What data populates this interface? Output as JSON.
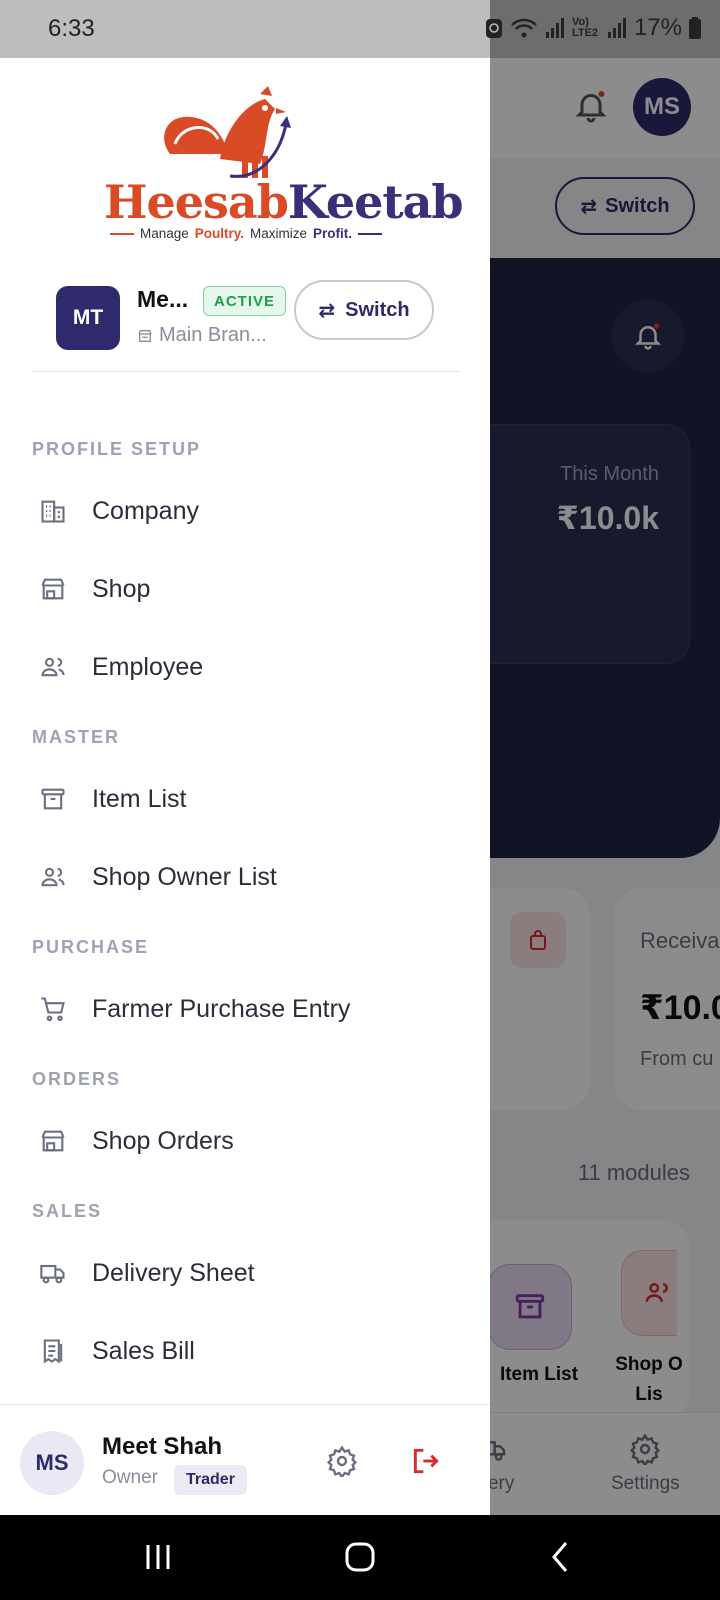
{
  "status_bar": {
    "time": "6:33",
    "network": "Vo) LTE2",
    "battery": "17%"
  },
  "background": {
    "avatar_initials": "MS",
    "switch_label": "Switch",
    "month_label": "This Month",
    "month_value": "₹10.0k",
    "receivable_label": "Receiva",
    "receivable_value": "₹10.0",
    "receivable_sub": "From cu",
    "modules_count": "11 modules",
    "module_item_list": "Item List",
    "module_shop_owner": "Shop O Lis",
    "nav_delivery": "livery",
    "nav_settings": "Settings"
  },
  "drawer": {
    "logo": {
      "part1": "Heesab",
      "part2": "Keetab",
      "tag_manage": "Manage",
      "tag_poultry": "Poultry.",
      "tag_maximize": "Maximize",
      "tag_profit": "Profit."
    },
    "shop": {
      "initials": "MT",
      "name": "Me...",
      "status": "ACTIVE",
      "branch": "Main Bran...",
      "switch_label": "Switch"
    },
    "sections": {
      "profile_setup": "PROFILE SETUP",
      "master": "MASTER",
      "purchase": "PURCHASE",
      "orders": "ORDERS",
      "sales": "SALES"
    },
    "items": {
      "company": "Company",
      "shop": "Shop",
      "employee": "Employee",
      "item_list": "Item List",
      "shop_owner_list": "Shop Owner List",
      "farmer_purchase_entry": "Farmer Purchase Entry",
      "shop_orders": "Shop Orders",
      "delivery_sheet": "Delivery Sheet",
      "sales_bill": "Sales Bill"
    },
    "footer": {
      "initials": "MS",
      "name": "Meet Shah",
      "role": "Owner",
      "badge": "Trader"
    }
  },
  "colors": {
    "brand_navy": "#2e2a6b",
    "brand_orange": "#d94a27",
    "active_green": "#1e9e4e",
    "logout_red": "#d32f2f"
  }
}
